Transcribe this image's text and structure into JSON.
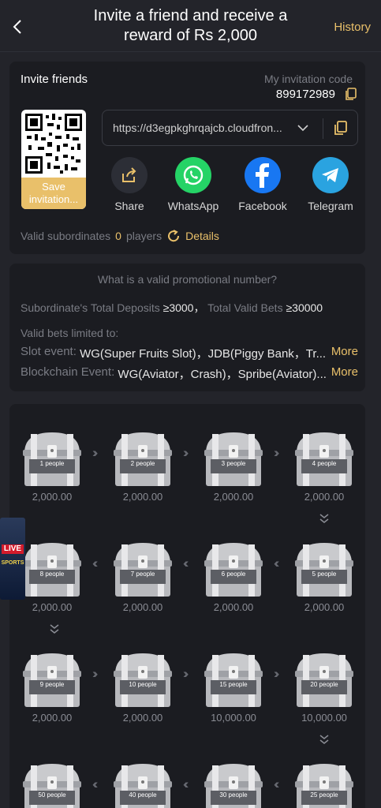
{
  "header": {
    "title": "Invite a friend and receive a reward of Rs 2,000",
    "history_label": "History"
  },
  "invite": {
    "section_label": "Invite friends",
    "code_label": "My invitation code",
    "code_value": "899172989",
    "qr_save_label": "Save invitation...",
    "link": "https://d3egpkghrqajcb.cloudfron...",
    "share_options": [
      {
        "label": "Share",
        "icon": "share-icon"
      },
      {
        "label": "WhatsApp",
        "icon": "whatsapp-icon"
      },
      {
        "label": "Facebook",
        "icon": "facebook-icon"
      },
      {
        "label": "Telegram",
        "icon": "telegram-icon"
      }
    ],
    "valid_label": "Valid subordinates",
    "valid_count": "0",
    "valid_unit": "players",
    "details_label": "Details"
  },
  "info": {
    "question": "What is a valid promotional number?",
    "deposits_label": "Subordinate's Total Deposits",
    "deposits_value": "≥3000，",
    "bets_label": "Total Valid Bets",
    "bets_value": "≥30000",
    "limited_label": "Valid bets limited to:",
    "slot_label": "Slot event:",
    "slot_value": "WG(Super Fruits Slot)，JDB(Piggy Bank，Tr...",
    "blockchain_label": "Blockchain Event:",
    "blockchain_value": "WG(Aviator，Crash)，Spribe(Aviator)...",
    "more_label": "More"
  },
  "rewards": {
    "rows": [
      [
        {
          "label": "1 people",
          "amount": "2,000.00"
        },
        {
          "label": "2 people",
          "amount": "2,000.00"
        },
        {
          "label": "3 people",
          "amount": "2,000.00"
        },
        {
          "label": "4 people",
          "amount": "2,000.00"
        }
      ],
      [
        {
          "label": "8 people",
          "amount": "2,000.00"
        },
        {
          "label": "7 people",
          "amount": "2,000.00"
        },
        {
          "label": "6 people",
          "amount": "2,000.00"
        },
        {
          "label": "5 people",
          "amount": "2,000.00"
        }
      ],
      [
        {
          "label": "9 people",
          "amount": "2,000.00"
        },
        {
          "label": "10 people",
          "amount": "2,000.00"
        },
        {
          "label": "15 people",
          "amount": "10,000.00"
        },
        {
          "label": "20 people",
          "amount": "10,000.00"
        }
      ],
      [
        {
          "label": "50 people",
          "amount": ""
        },
        {
          "label": "40 people",
          "amount": ""
        },
        {
          "label": "30 people",
          "amount": ""
        },
        {
          "label": "25 people",
          "amount": ""
        }
      ]
    ]
  },
  "live_badge": {
    "top": "LIVE",
    "bottom": "SPORTS"
  },
  "colors": {
    "accent": "#e9c06a",
    "bg": "#23242a",
    "card": "#1b1c21"
  }
}
